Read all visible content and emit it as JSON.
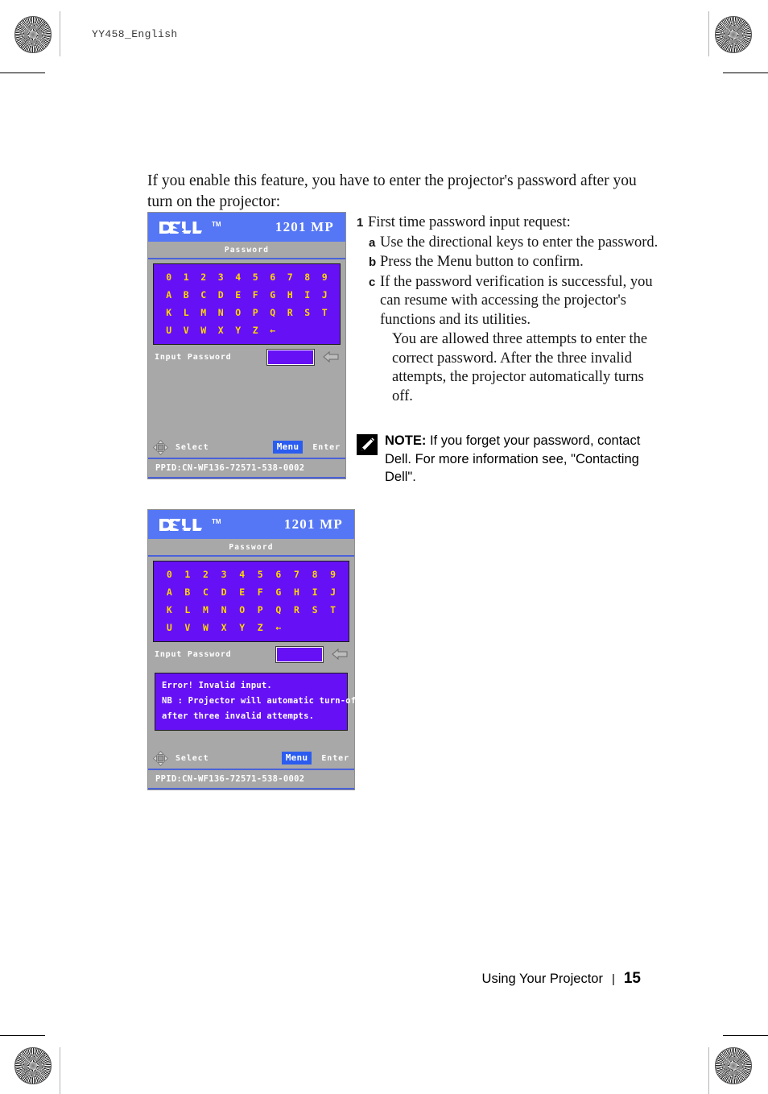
{
  "page": {
    "header_mark": "YY458_English",
    "footer_section": "Using Your Projector",
    "footer_separator": "|",
    "page_number": "15"
  },
  "intro": {
    "paragraph": "If you enable this feature, you have to enter the projector's password after you turn on the projector:"
  },
  "steps": {
    "item1_marker": "1",
    "item1_text": "First time password input request:",
    "sub_a_marker": "a",
    "sub_a_text": "Use the directional keys to enter the password.",
    "sub_b_marker": "b",
    "sub_b_text": "Press the Menu button to confirm.",
    "sub_c_marker": "c",
    "sub_c_text": "If the password verification is successful, you can resume with accessing the projector's functions and its utilities.",
    "sub_c_note": "You are allowed three attempts to enter the correct password. After the three invalid attempts, the projector automatically turns off."
  },
  "note": {
    "icon": "note-pencil-icon",
    "lead": "NOTE:",
    "text": "If you forget your password, contact Dell. For more information see, \"Contacting Dell\"."
  },
  "osd": {
    "brand": "DELL",
    "brand_tm": "TM",
    "model": "1201 MP",
    "subtitle": "Password",
    "keypad_rows": [
      [
        "0",
        "1",
        "2",
        "3",
        "4",
        "5",
        "6",
        "7",
        "8",
        "9"
      ],
      [
        "A",
        "B",
        "C",
        "D",
        "E",
        "F",
        "G",
        "H",
        "I",
        "J"
      ],
      [
        "K",
        "L",
        "M",
        "N",
        "O",
        "P",
        "Q",
        "R",
        "S",
        "T"
      ],
      [
        "U",
        "V",
        "W",
        "X",
        "Y",
        "Z",
        "←"
      ]
    ],
    "input_label": "Input Password",
    "input_value": "",
    "back_arrow_icon": "left-arrow-icon",
    "nav_icon": "four-way-navigation-icon",
    "hint_select": "Select",
    "hint_menu": "Menu",
    "hint_enter": "Enter",
    "ppid": "PPID:CN-WF136-72571-538-0002",
    "error_lines": [
      "Error!  Invalid input.",
      "NB : Projector will automatic turn-off",
      "after three invalid attempts."
    ]
  },
  "colors": {
    "titlebar_blue": "#5577f5",
    "panel_gray": "#a8a8a8",
    "keypad_purple": "#6611f5",
    "key_yellow": "#ffd700",
    "menu_badge_blue": "#2b5cf0",
    "divider_blue": "#4a62d8"
  }
}
